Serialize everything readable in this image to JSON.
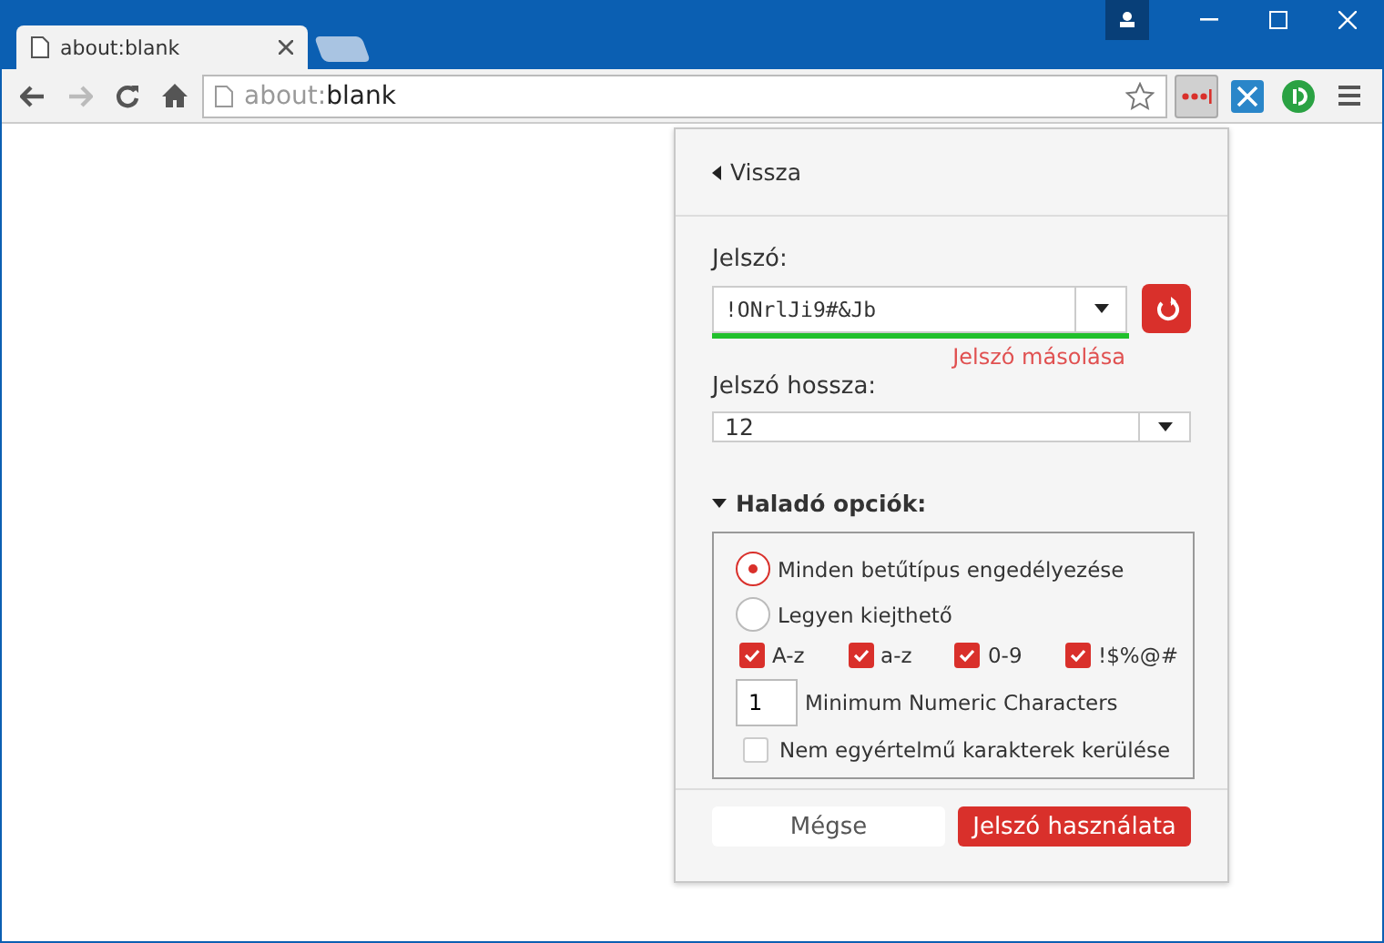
{
  "tabs": [
    {
      "label": "about:blank",
      "selected": true
    }
  ],
  "address": {
    "scheme": "about:",
    "rest": "blank"
  },
  "popup": {
    "back": "Vissza",
    "password": {
      "label": "Jelszó:",
      "value": "!ONrlJi9#&Jb",
      "level": 1,
      "copy": "Jelszó másolása"
    },
    "length": {
      "label": "Jelszó hossza:",
      "value": "12"
    },
    "advanced": {
      "label": "Haladó opciók:",
      "expanded": true,
      "modes": [
        {
          "label": "Minden betűtípus engedélyezése",
          "selected": true
        },
        {
          "label": "Legyen kiejthető",
          "selected": false
        }
      ],
      "charsets": [
        {
          "label": "A-z",
          "checked": true
        },
        {
          "label": "a-z",
          "checked": true
        },
        {
          "label": "0-9",
          "checked": true
        },
        {
          "label": "!$%@#",
          "checked": true
        }
      ],
      "min_numeric": {
        "value": "1",
        "label": "Minimum Numeric Characters"
      },
      "avoid_ambiguous": {
        "label": "Nem egyértelmű karakterek kerülése",
        "checked": false
      }
    },
    "buttons": [
      {
        "label": "Mégse",
        "kind": "secondary"
      },
      {
        "label": "Jelszó használata",
        "kind": "primary"
      }
    ]
  }
}
